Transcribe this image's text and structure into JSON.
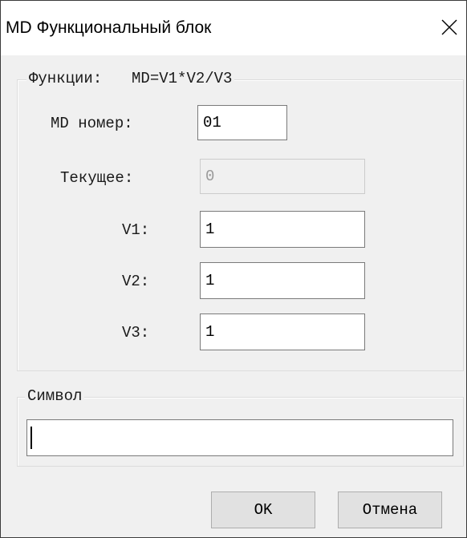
{
  "window": {
    "title": "MD Функциональный блок",
    "close_icon": "close-icon"
  },
  "functions_group": {
    "legend_label": "Функции:",
    "legend_formula": "MD=V1*V2/V3",
    "md_number_label": "MD номер:",
    "md_number_value": "01",
    "current_label": "Текущее:",
    "current_value": "0",
    "v1_label": "V1:",
    "v1_value": "1",
    "v2_label": "V2:",
    "v2_value": "1",
    "v3_label": "V3:",
    "v3_value": "1"
  },
  "symbol_group": {
    "legend": "Символ",
    "value": ""
  },
  "buttons": {
    "ok_label": "OK",
    "cancel_label": "Отмена"
  }
}
